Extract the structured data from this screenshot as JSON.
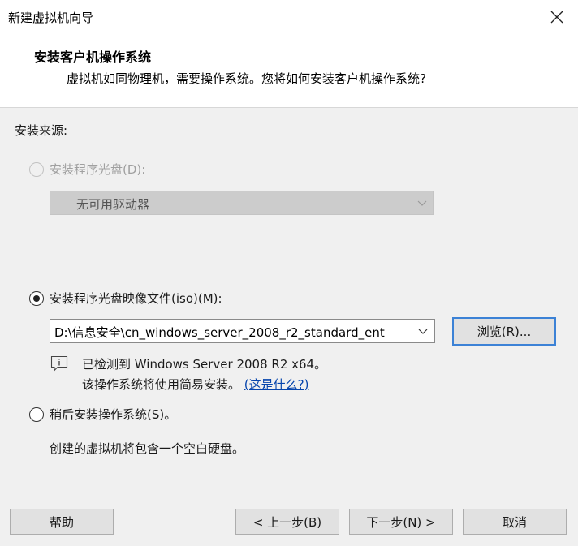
{
  "window": {
    "title": "新建虚拟机向导"
  },
  "header": {
    "title": "安装客户机操作系统",
    "description": "虚拟机如同物理机，需要操作系统。您将如何安装客户机操作系统?"
  },
  "source": {
    "label": "安装来源:",
    "disc": {
      "label": "安装程序光盘(D):",
      "selected": false,
      "enabled": false,
      "drive_value": "无可用驱动器"
    },
    "iso": {
      "label": "安装程序光盘映像文件(iso)(M):",
      "selected": true,
      "path_value": "D:\\信息安全\\cn_windows_server_2008_r2_standard_ent",
      "browse_label": "浏览(R)..."
    },
    "detected": {
      "line1": "已检测到 Windows Server 2008 R2 x64。",
      "line2_text": "该操作系统将使用简易安装。",
      "link_text": "(这是什么?)"
    },
    "later": {
      "label": "稍后安装操作系统(S)。",
      "selected": false,
      "description": "创建的虚拟机将包含一个空白硬盘。"
    }
  },
  "buttons": {
    "help": "帮助",
    "back": "< 上一步(B)",
    "next": "下一步(N) >",
    "cancel": "取消"
  },
  "colors": {
    "accent": "#3c82d6",
    "link": "#0645ad",
    "panel": "#f0f0f0"
  }
}
